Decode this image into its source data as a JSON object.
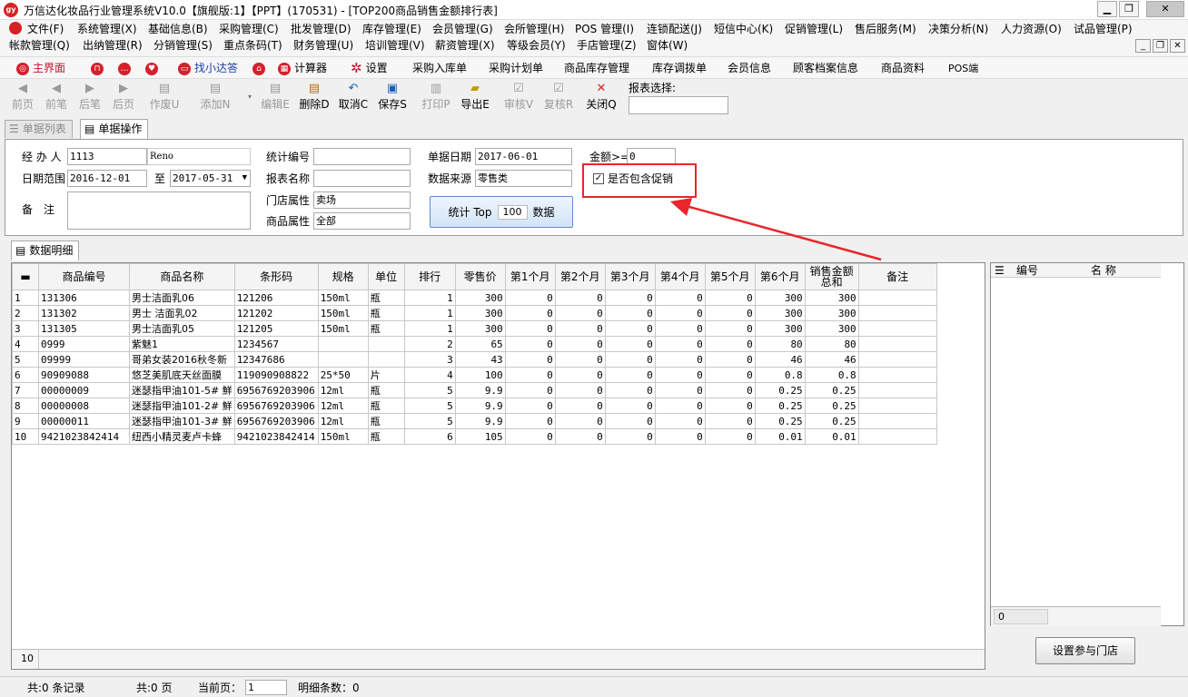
{
  "window": {
    "logo": "gy",
    "title": "万信达化妆品行业管理系统V10.0【旗舰版:1】【PPT】(170531) - [TOP200商品销售金额排行表]"
  },
  "menu_row1": [
    "文件(F)",
    "系统管理(X)",
    "基础信息(B)",
    "采购管理(C)",
    "批发管理(D)",
    "库存管理(E)",
    "会员管理(G)",
    "会所管理(H)",
    "POS 管理(I)",
    "连锁配送(J)",
    "短信中心(K)",
    "促销管理(L)",
    "售后服务(M)",
    "决策分析(N)",
    "人力资源(O)",
    "试品管理(P)"
  ],
  "menu_row2": [
    "帐款管理(Q)",
    "出纳管理(R)",
    "分销管理(S)",
    "重点条码(T)",
    "财务管理(U)",
    "培训管理(V)",
    "薪资管理(X)",
    "等级会员(Y)",
    "手店管理(Z)",
    "窗体(W)"
  ],
  "quickbar": {
    "main": "主界面",
    "assistant": "找小达答",
    "calculator": "计算器",
    "settings": "设置",
    "links": [
      "采购入库单",
      "采购计划单",
      "商品库存管理",
      "库存调拨单",
      "会员信息",
      "顾客档案信息",
      "商品资料",
      "POS端"
    ]
  },
  "toolbar": {
    "first": "前页",
    "prev": "前笔",
    "next": "后笔",
    "last": "后页",
    "void": "作废U",
    "add": "添加N",
    "edit": "编辑E",
    "delete": "删除D",
    "cancel": "取消C",
    "save": "保存S",
    "print": "打印P",
    "export": "导出E",
    "audit": "审核V",
    "reaudit": "复核R",
    "close": "关闭Q",
    "report_select_label": "报表选择:"
  },
  "tabs": {
    "list": "单据列表",
    "operate": "单据操作",
    "detail": "数据明细"
  },
  "form": {
    "handler_label": "经 办 人",
    "handler_code": "1113",
    "handler_name": "Reno",
    "date_range_label": "日期范围",
    "date_from": "2016-12-01",
    "to_label": "至",
    "date_to": "2017-05-31",
    "remark_label": "备　注",
    "remark": "",
    "stat_no_label": "统计编号",
    "stat_no": "",
    "report_name_label": "报表名称",
    "report_name": "",
    "store_attr_label": "门店属性",
    "store_attr": "卖场",
    "goods_attr_label": "商品属性",
    "goods_attr": "全部",
    "doc_date_label": "单据日期",
    "doc_date": "2017-06-01",
    "source_label": "数据来源",
    "source": "零售类",
    "amount_label": "金额>=",
    "amount": "0",
    "promo_label": "是否包含促销",
    "stat_btn_prefix": "统计 Top",
    "stat_btn_top": "100",
    "stat_btn_suffix": "数据"
  },
  "grid": {
    "headers": [
      "商品编号",
      "商品名称",
      "条形码",
      "规格",
      "单位",
      "排行",
      "零售价",
      "第1个月",
      "第2个月",
      "第3个月",
      "第4个月",
      "第5个月",
      "第6个月",
      "销售金额总和",
      "备注"
    ],
    "rows": [
      [
        "1",
        "131306",
        "男士洁面乳06",
        "121206",
        "150ml",
        "瓶",
        "1",
        "300",
        "0",
        "0",
        "0",
        "0",
        "0",
        "300",
        "300",
        ""
      ],
      [
        "2",
        "131302",
        "男士 洁面乳02",
        "121202",
        "150ml",
        "瓶",
        "1",
        "300",
        "0",
        "0",
        "0",
        "0",
        "0",
        "300",
        "300",
        ""
      ],
      [
        "3",
        "131305",
        "男士洁面乳05",
        "121205",
        "150ml",
        "瓶",
        "1",
        "300",
        "0",
        "0",
        "0",
        "0",
        "0",
        "300",
        "300",
        ""
      ],
      [
        "4",
        "0999",
        "紫魅1",
        "1234567",
        "",
        "",
        "2",
        "65",
        "0",
        "0",
        "0",
        "0",
        "0",
        "80",
        "80",
        ""
      ],
      [
        "5",
        "09999",
        "哥弟女装2016秋冬新",
        "12347686",
        "",
        "",
        "3",
        "43",
        "0",
        "0",
        "0",
        "0",
        "0",
        "46",
        "46",
        ""
      ],
      [
        "6",
        "90909088",
        "悠芝美肌底天丝面膜",
        "119090908822",
        "25*50",
        "片",
        "4",
        "100",
        "0",
        "0",
        "0",
        "0",
        "0",
        "0.8",
        "0.8",
        ""
      ],
      [
        "7",
        "00000009",
        "迷瑟指甲油101-5# 鮮",
        "6956769203906",
        "12ml",
        "瓶",
        "5",
        "9.9",
        "0",
        "0",
        "0",
        "0",
        "0",
        "0.25",
        "0.25",
        ""
      ],
      [
        "8",
        "00000008",
        "迷瑟指甲油101-2# 鮮",
        "6956769203906",
        "12ml",
        "瓶",
        "5",
        "9.9",
        "0",
        "0",
        "0",
        "0",
        "0",
        "0.25",
        "0.25",
        ""
      ],
      [
        "9",
        "00000011",
        "迷瑟指甲油101-3# 鮮",
        "6956769203906",
        "12ml",
        "瓶",
        "5",
        "9.9",
        "0",
        "0",
        "0",
        "0",
        "0",
        "0.25",
        "0.25",
        ""
      ],
      [
        "10",
        "9421023842414",
        "纽西小精灵麦卢卡蜂",
        "9421023842414",
        "150ml",
        "瓶",
        "6",
        "105",
        "0",
        "0",
        "0",
        "0",
        "0",
        "0.01",
        "0.01",
        ""
      ]
    ],
    "footer_count": "10"
  },
  "right_panel": {
    "headers": [
      "编号",
      "名 称"
    ],
    "footer": "0",
    "button": "设置参与门店"
  },
  "status": {
    "records": "共:0 条记录",
    "pages": "共:0 页",
    "current_label": "当前页：",
    "current": "1",
    "detail_count": "明细条数：0"
  },
  "colors": {
    "highlight": "#e8262b",
    "brand": "#d4202c"
  }
}
